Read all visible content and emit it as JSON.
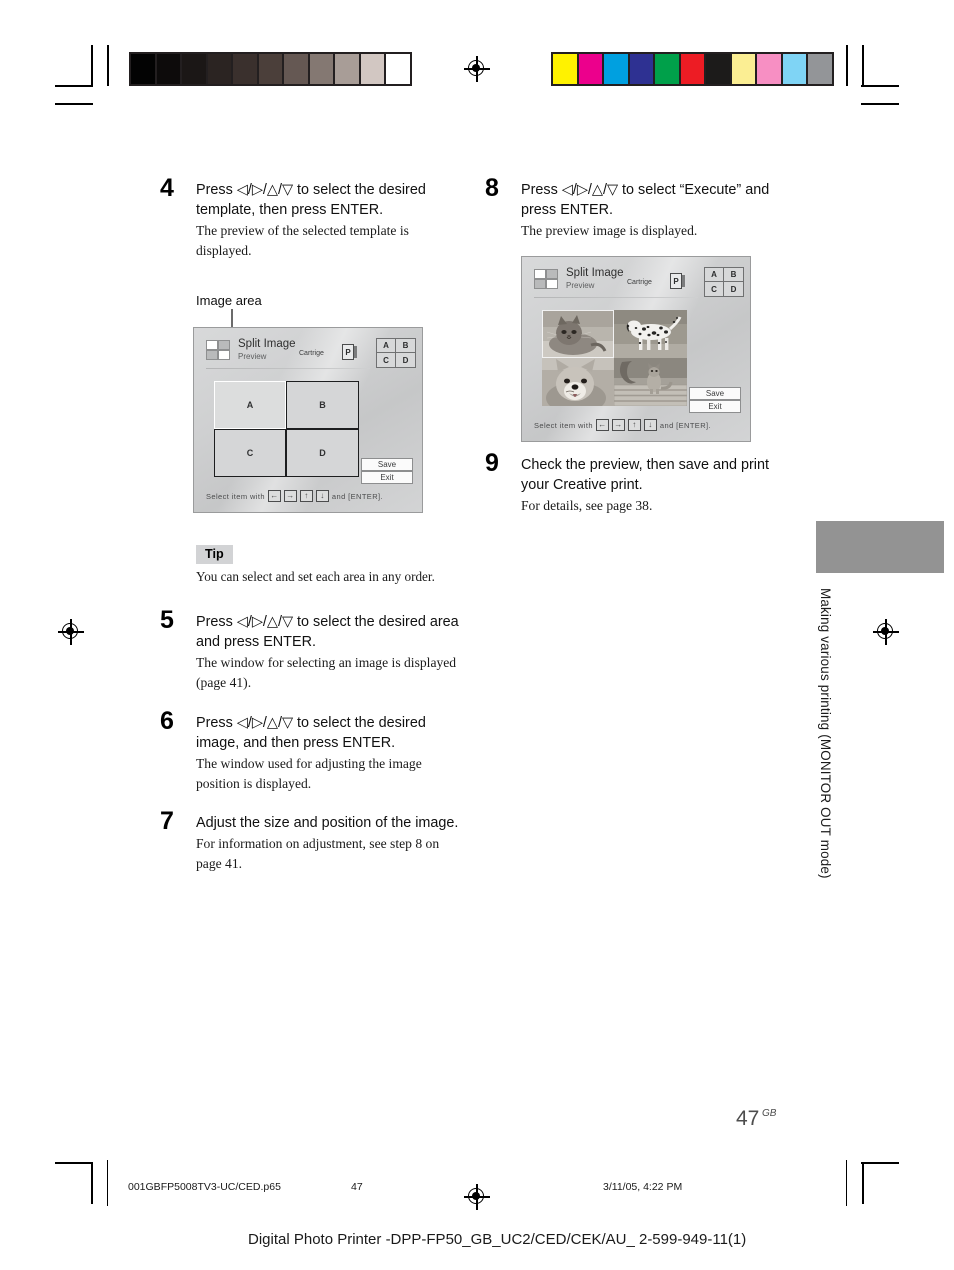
{
  "document": {
    "page_number": "47",
    "page_region": "GB",
    "sidebar_text": "Making various printing (MONITOR OUT mode)",
    "footer_file": "001GBFP5008TV3-UC/CED.p65",
    "footer_page": "47",
    "footer_timestamp": "3/11/05, 4:22 PM",
    "caption": "Digital Photo Printer -DPP-FP50_GB_UC2/CED/CEK/AU_ 2-599-949-11(1)"
  },
  "calibration": {
    "grayscale_bar": [
      "#030303",
      "#0d0b0b",
      "#1b1716",
      "#2b2422",
      "#3a302d",
      "#4b3f3a",
      "#655853",
      "#847872",
      "#a89d97",
      "#d2c7c2",
      "#ffffff"
    ],
    "color_bar": [
      "#fff200",
      "#ec008c",
      "#00a0e0",
      "#2e3192",
      "#00a04a",
      "#ed1c24",
      "#1c1b1a",
      "#fbee93",
      "#f78fc3",
      "#7fd4f5",
      "#939598"
    ]
  },
  "left_column": {
    "steps": [
      {
        "number": "4",
        "lead": "Press ◁/▷/△/▽ to select the desired template, then press ENTER.",
        "desc": "The preview of the selected template is displayed."
      },
      {
        "number": "5",
        "lead": "Press ◁/▷/△/▽ to select the desired area and press ENTER.",
        "desc": "The window for selecting an image is displayed (page 41)."
      },
      {
        "number": "6",
        "lead": "Press ◁/▷/△/▽ to select the desired image, and then press ENTER.",
        "desc": "The window used for adjusting the image position is displayed."
      },
      {
        "number": "7",
        "lead": "Adjust the size and position of the image.",
        "desc": "For information on adjustment, see step 8 on page 41."
      }
    ],
    "callout": "Image area",
    "tip": {
      "label": "Tip",
      "text": "You can select and set each area in any order."
    }
  },
  "right_column": {
    "steps": [
      {
        "number": "8",
        "lead": "Press ◁/▷/△/▽ to select “Execute” and press ENTER.",
        "desc": "The preview image is displayed."
      },
      {
        "number": "9",
        "lead": "Check the preview, then save and print your Creative print.",
        "desc": "For details, see page 38."
      }
    ]
  },
  "lcd_template": {
    "title": "Split Image",
    "subtitle": "Preview",
    "cartridge_label": "Cartrige",
    "cartridge_value": "P",
    "area_grid": [
      "A",
      "B",
      "C",
      "D"
    ],
    "quadrants": [
      "A",
      "B",
      "C",
      "D"
    ],
    "buttons": [
      "Save",
      "Exit"
    ],
    "status_prefix": "Select item with",
    "status_keys": [
      "←",
      "→",
      "↑",
      "↓"
    ],
    "status_suffix": "and [ENTER]."
  },
  "lcd_preview": {
    "title": "Split Image",
    "subtitle": "Preview",
    "cartridge_label": "Cartrige",
    "cartridge_value": "P",
    "area_grid": [
      "A",
      "B",
      "C",
      "D"
    ],
    "buttons": [
      "Save",
      "Exit"
    ],
    "status_prefix": "Select item with",
    "status_keys": [
      "←",
      "→",
      "↑",
      "↓"
    ],
    "status_suffix": "and [ENTER].",
    "photos": [
      "cat-photo",
      "dalmatian-photo",
      "dog-photo",
      "cat-on-bench-photo"
    ]
  }
}
